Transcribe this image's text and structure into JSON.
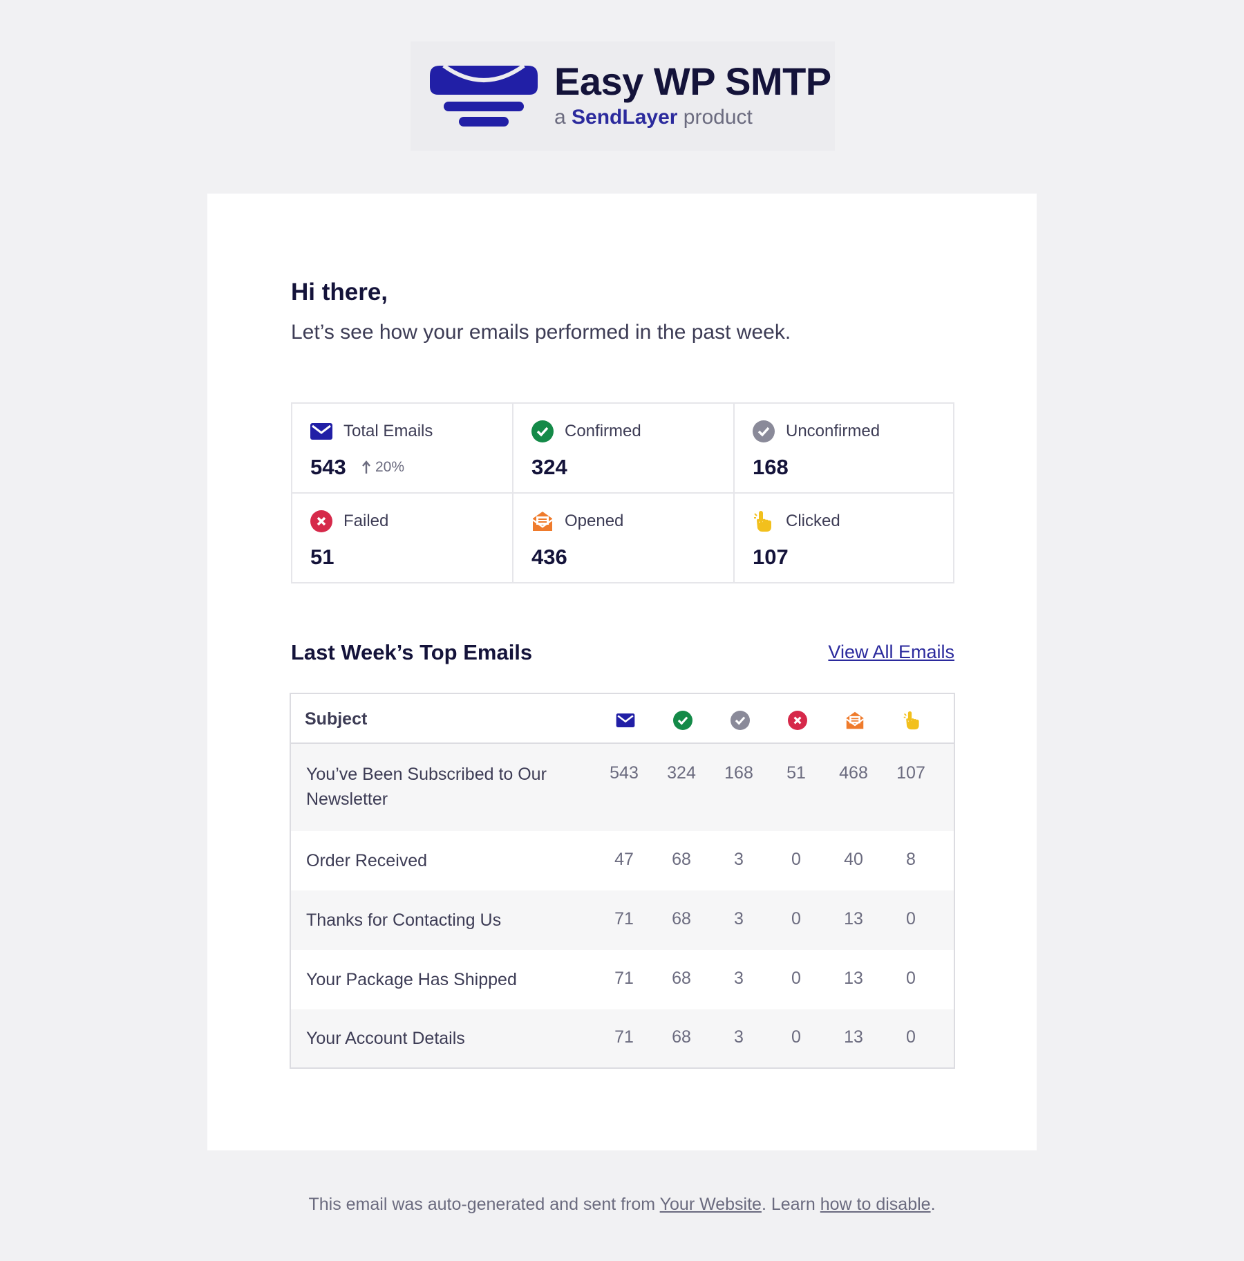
{
  "brand": {
    "title": "Easy WP SMTP",
    "sub_prefix": "a",
    "sub_brand": "SendLayer",
    "sub_suffix": "product",
    "color": "#211fa6"
  },
  "greeting": "Hi there,",
  "intro": "Let’s see how your emails performed in the past week.",
  "stats": [
    {
      "label": "Total Emails",
      "value": "543",
      "trend": "20%",
      "icon": "envelope-icon"
    },
    {
      "label": "Confirmed",
      "value": "324",
      "icon": "check-circle-icon"
    },
    {
      "label": "Unconfirmed",
      "value": "168",
      "icon": "grey-check-circle-icon"
    },
    {
      "label": "Failed",
      "value": "51",
      "icon": "x-circle-icon"
    },
    {
      "label": "Opened",
      "value": "436",
      "icon": "open-envelope-icon"
    },
    {
      "label": "Clicked",
      "value": "107",
      "icon": "pointer-hand-icon"
    }
  ],
  "top_emails": {
    "title": "Last Week’s Top Emails",
    "view_all": "View All Emails",
    "subject_header": "Subject",
    "rows": [
      {
        "subject": "You’ve Been Subscribed to Our Newsletter",
        "values": [
          "543",
          "324",
          "168",
          "51",
          "468",
          "107"
        ]
      },
      {
        "subject": "Order Received",
        "values": [
          "47",
          "68",
          "3",
          "0",
          "40",
          "8"
        ]
      },
      {
        "subject": "Thanks for Contacting Us",
        "values": [
          "71",
          "68",
          "3",
          "0",
          "13",
          "0"
        ]
      },
      {
        "subject": "Your Package Has Shipped",
        "values": [
          "71",
          "68",
          "3",
          "0",
          "13",
          "0"
        ]
      },
      {
        "subject": "Your Account Details",
        "values": [
          "71",
          "68",
          "3",
          "0",
          "13",
          "0"
        ]
      }
    ]
  },
  "footer": {
    "prefix": "This email was auto-generated and sent from",
    "site_link": "Your Website",
    "middle": ". Learn",
    "disable_link": "how to disable",
    "suffix": "."
  },
  "colors": {
    "blue": "#211fa6",
    "green": "#148a48",
    "grey": "#8a8a99",
    "red": "#d6294a",
    "orange": "#ef7b2c",
    "yellow": "#f2c01d"
  }
}
